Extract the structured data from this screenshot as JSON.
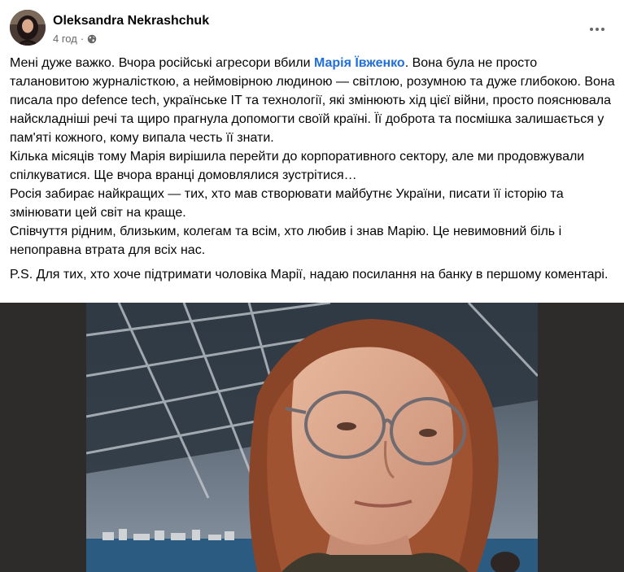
{
  "post": {
    "author": {
      "name": "Oleksandra Nekrashchuk",
      "avatar_icon": "profile-photo"
    },
    "meta": {
      "time": "4 год",
      "separator": "·",
      "audience_icon": "globe-icon"
    },
    "more_icon": "more-options-icon",
    "body": {
      "p1_before": "Мені дуже важко. Вчора російські агресори вбили ",
      "p1_mention": "Марія Ївженко",
      "p1_after": ". Вона була не просто талановитою журналісткою, а неймовірною людиною — світлою, розумною та дуже глибокою. Вона писала про defence tech, українське IT та технології, які змінюють хід цієї війни, просто пояснювала найскладніші речі та щиро прагнула допомогти своїй країні. Її доброта та посмішка залишається у пам'яті кожного, кому випала честь її знати.",
      "p2": "Кілька місяців тому Марія вирішила перейти до корпоративного сектору, але ми продовжували спілкуватися. Ще вчора вранці домовлялися зустрітися…",
      "p3": "Росія забирає найкращих — тих, хто мав створювати майбутнє України, писати її історію та змінювати цей світ на краще.",
      "p4": "Співчуття рідним, близьким, колегам та всім, хто любив і знав Марію. Це невимовний біль і непоправна втрата для всіх нас.",
      "p5": "P.S. Для тих, хто хоче підтримати чоловіка Марії, надаю посилання на банку в першому коментарі."
    },
    "photo": {
      "subject": "portrait-photo"
    }
  },
  "colors": {
    "mention": "#216fdb",
    "meta": "#65676b",
    "photo_background": "#2d2c2b"
  }
}
